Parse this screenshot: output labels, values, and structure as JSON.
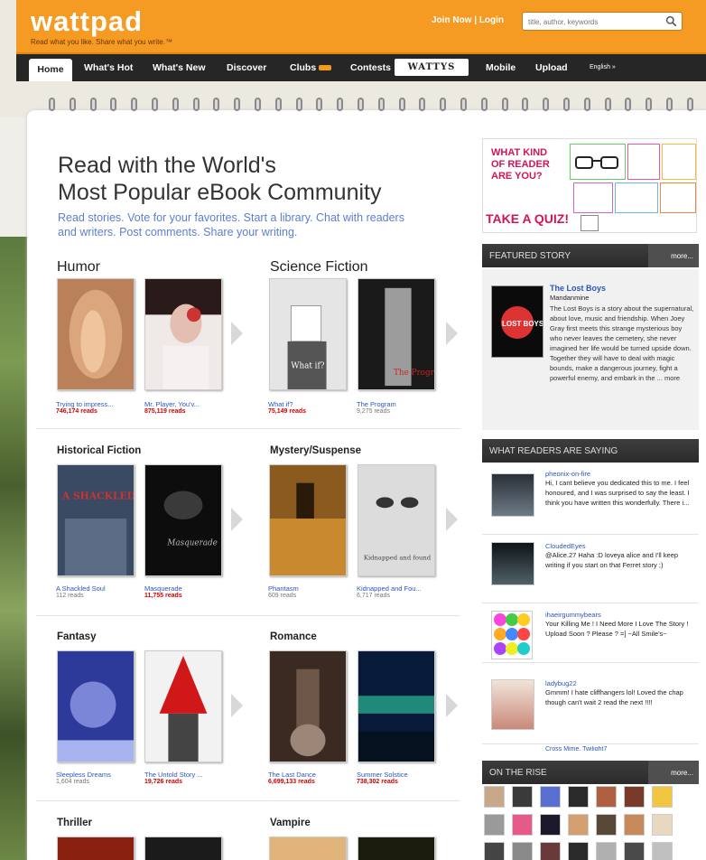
{
  "header": {
    "logo": "wattpad",
    "tagline": "Read what you like. Share what you write.™",
    "join": "Join Now",
    "sep": "|",
    "login": "Login",
    "search_placeholder": "title, author, keywords"
  },
  "nav": {
    "home": "Home",
    "whats_hot": "What's Hot",
    "whats_new": "What's New",
    "discover": "Discover",
    "clubs": "Clubs",
    "contests": "Contests",
    "wattys": "WATTYS",
    "mobile": "Mobile",
    "upload": "Upload",
    "lang": "English »"
  },
  "hero": {
    "line1": "Read with the World's",
    "line2": "Most Popular eBook Community",
    "sub": "Read stories. Vote for your favorites. Start a library. Chat with readers and writers. Post comments. Share your writing."
  },
  "categories": [
    {
      "name": "Humor",
      "books": [
        {
          "title": "Trying to impress...",
          "reads": "746,174 reads",
          "hot": true
        },
        {
          "title": "Mr. Player, You'v...",
          "reads": "875,119 reads",
          "hot": true
        }
      ]
    },
    {
      "name": "Science Fiction",
      "books": [
        {
          "title": "What if?",
          "reads": "75,149 reads",
          "hot": true
        },
        {
          "title": "The Program",
          "reads": "9,275 reads",
          "hot": false
        }
      ]
    },
    {
      "name": "Historical Fiction",
      "books": [
        {
          "title": "A Shackled Soul",
          "reads": "112 reads",
          "hot": false
        },
        {
          "title": "Masquerade",
          "reads": "11,755 reads",
          "hot": true
        }
      ]
    },
    {
      "name": "Mystery/Suspense",
      "books": [
        {
          "title": "Phantasm",
          "reads": "609 reads",
          "hot": false
        },
        {
          "title": "Kidnapped and Fou...",
          "reads": "6,717 reads",
          "hot": false
        }
      ]
    },
    {
      "name": "Fantasy",
      "books": [
        {
          "title": "Sleepless Dreams",
          "reads": "1,604 reads",
          "hot": false
        },
        {
          "title": "The Untold Story ...",
          "reads": "19,726 reads",
          "hot": true
        }
      ]
    },
    {
      "name": "Romance",
      "books": [
        {
          "title": "The Last Dance",
          "reads": "6,699,133 reads",
          "hot": true
        },
        {
          "title": "Summer Solstice",
          "reads": "738,302 reads",
          "hot": true
        }
      ]
    },
    {
      "name": "Thriller",
      "books": []
    },
    {
      "name": "Vampire",
      "books": []
    }
  ],
  "cover_text": {
    "what_if": "What if?",
    "program": "The Program",
    "shackled": "A SHACKLED SOUL",
    "masquerade": "Masquerade",
    "kidnapped": "Kidnapped and found",
    "lost_boys": "LOST BOYS"
  },
  "quiz": {
    "line1": "WHAT KIND",
    "line2": "OF READER",
    "line3": "ARE YOU?",
    "cta": "TAKE A QUIZ!"
  },
  "featured": {
    "header": "FEATURED STORY",
    "more": "more...",
    "title": "The Lost Boys",
    "author": "Mandanmine",
    "description": "The Lost Boys is a story about the supernatural, about love, music and friendship. When Joey Gray first meets this strange mysterious boy who never leaves the cemetery, she never imagined her life would be turned upside down. Together they will have to deal with magic bounds, make a dangerous journey, fight a powerful enemy, and embark in the ... more"
  },
  "readers": {
    "header": "WHAT READERS ARE SAYING",
    "comments": [
      {
        "user": "pheonix-on-fire",
        "text": "Hi, I cant believe you dedicated this to me. I feel honoured, and I was surprised to say the least. I think you have written this wonderfully. There i..."
      },
      {
        "user": "CloudedEyes",
        "text": "@Alice.27 Haha :D loveya alice and I'll keep writing if you start on that Ferret story ;)"
      },
      {
        "user": "ihaeirgummybears",
        "text": "Your Killing Me ! I Need More I Love The Story ! Upload Soon ? Please ? =] ~All Smile's~"
      },
      {
        "user": "ladybug22",
        "text": "Gmmm! I hate cliffhangers lol! Loved the chap though can't wait 2 read the next !!!!"
      }
    ],
    "partial_user": "Cross Mime, Twilight7"
  },
  "rise": {
    "header": "ON THE RISE",
    "more": "more..."
  }
}
